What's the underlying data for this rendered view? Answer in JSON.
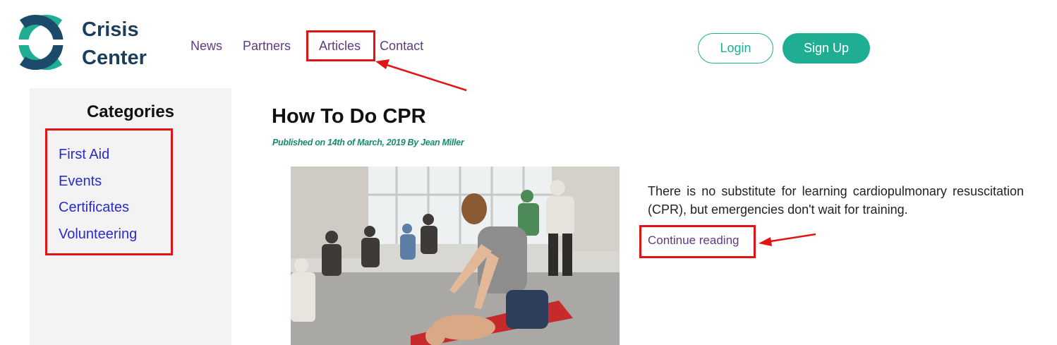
{
  "logo": {
    "line1": "Crisis",
    "line2": "Center",
    "colors": {
      "teal": "#1fae91",
      "navy": "#1b4a6b"
    }
  },
  "nav": {
    "items": [
      "News",
      "Partners",
      "Articles",
      "Contact"
    ]
  },
  "auth": {
    "login_label": "Login",
    "signup_label": "Sign Up"
  },
  "sidebar": {
    "title": "Categories",
    "items": [
      "First Aid",
      "Events",
      "Certificates",
      "Volunteering"
    ]
  },
  "article": {
    "title": "How To Do CPR",
    "byline": "Published on 14th of March, 2019 By Jean Miller",
    "image_icon": "cpr-training-photo",
    "excerpt": "There is no substitute for learning cardiopulmonary resuscitation (CPR), but emergencies don't wait for training.",
    "continue_label": "Continue reading"
  },
  "colors": {
    "accent": "#1fae91",
    "link": "#5e3b7e",
    "category_link": "#2a2acd",
    "annotation": "#e01414",
    "sidebar_bg": "#f3f3f3"
  }
}
